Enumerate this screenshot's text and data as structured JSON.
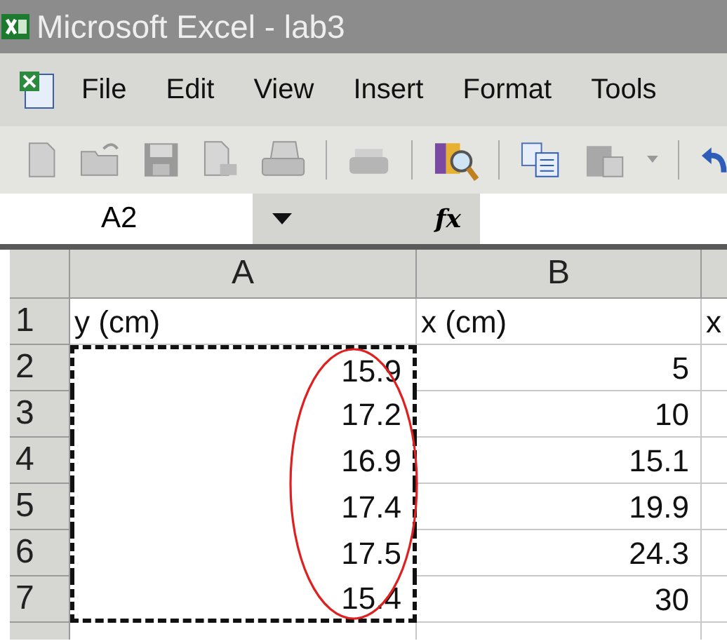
{
  "window": {
    "title": "Microsoft Excel - lab3"
  },
  "menu": [
    "File",
    "Edit",
    "View",
    "Insert",
    "Format",
    "Tools"
  ],
  "name_box": "A2",
  "function_label": "fx",
  "columns": [
    "A",
    "B"
  ],
  "annotation": {
    "kind": "ellipse"
  },
  "rows": [
    {
      "number": "1",
      "kind": "label",
      "cells": [
        "y (cm)",
        "x (cm)",
        "x"
      ],
      "copied": false
    },
    {
      "number": "2",
      "kind": "number",
      "cells": [
        "15.9",
        "5"
      ],
      "copied": true
    },
    {
      "number": "3",
      "kind": "number",
      "cells": [
        "17.2",
        "10"
      ],
      "copied": true
    },
    {
      "number": "4",
      "kind": "number",
      "cells": [
        "16.9",
        "15.1"
      ],
      "copied": true
    },
    {
      "number": "5",
      "kind": "number",
      "cells": [
        "17.4",
        "19.9"
      ],
      "copied": true
    },
    {
      "number": "6",
      "kind": "number",
      "cells": [
        "17.5",
        "24.3"
      ],
      "copied": true
    },
    {
      "number": "7",
      "kind": "number",
      "cells": [
        "15.4",
        "30"
      ],
      "copied": true
    }
  ]
}
